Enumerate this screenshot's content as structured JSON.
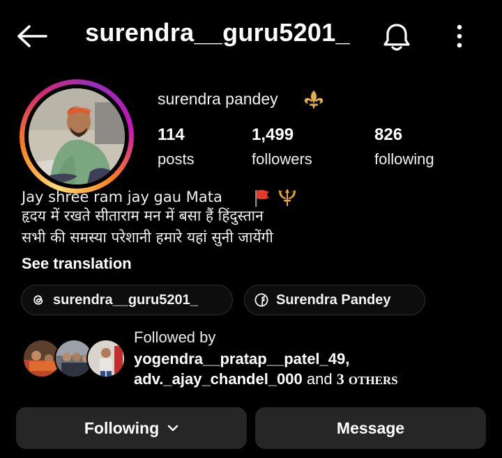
{
  "header": {
    "username": "surendra__guru5201_",
    "back_icon": "arrow-left-icon",
    "notifications_icon": "bell-icon",
    "more_icon": "more-vertical-icon"
  },
  "profile": {
    "display_name": "surendra pandey",
    "name_emoji": "fleur-de-lis",
    "ring_colors": [
      "#feda75",
      "#fa7e1e",
      "#d62976",
      "#962fbf"
    ]
  },
  "stats": [
    {
      "value": "114",
      "label": "posts"
    },
    {
      "value": "1,499",
      "label": "followers"
    },
    {
      "value": "826",
      "label": "following"
    }
  ],
  "bio": {
    "line1": "Jay shree ram jay gau Mata",
    "line1_emojis": [
      "flag-icon",
      "trident-icon"
    ],
    "line2": "हृदय में रखते सीताराम मन में बसा हैं हिंदुस्तान",
    "line3": "सभी की समस्या  परेशानी हमारे यहां सुनी जायेंगी",
    "see_translation": "See translation"
  },
  "links": {
    "threads": "surendra__guru5201_",
    "facebook": "Surendra Pandey"
  },
  "followed_by": {
    "label": "Followed by",
    "name1": "yogendra__pratap__patel_49,",
    "name2": "adv._ajay_chandel_000",
    "and_text": "and",
    "others_count": "3",
    "others_label": "OTHERS"
  },
  "actions": {
    "following_label": "Following",
    "message_label": "Message",
    "button_bg": "#262626"
  }
}
